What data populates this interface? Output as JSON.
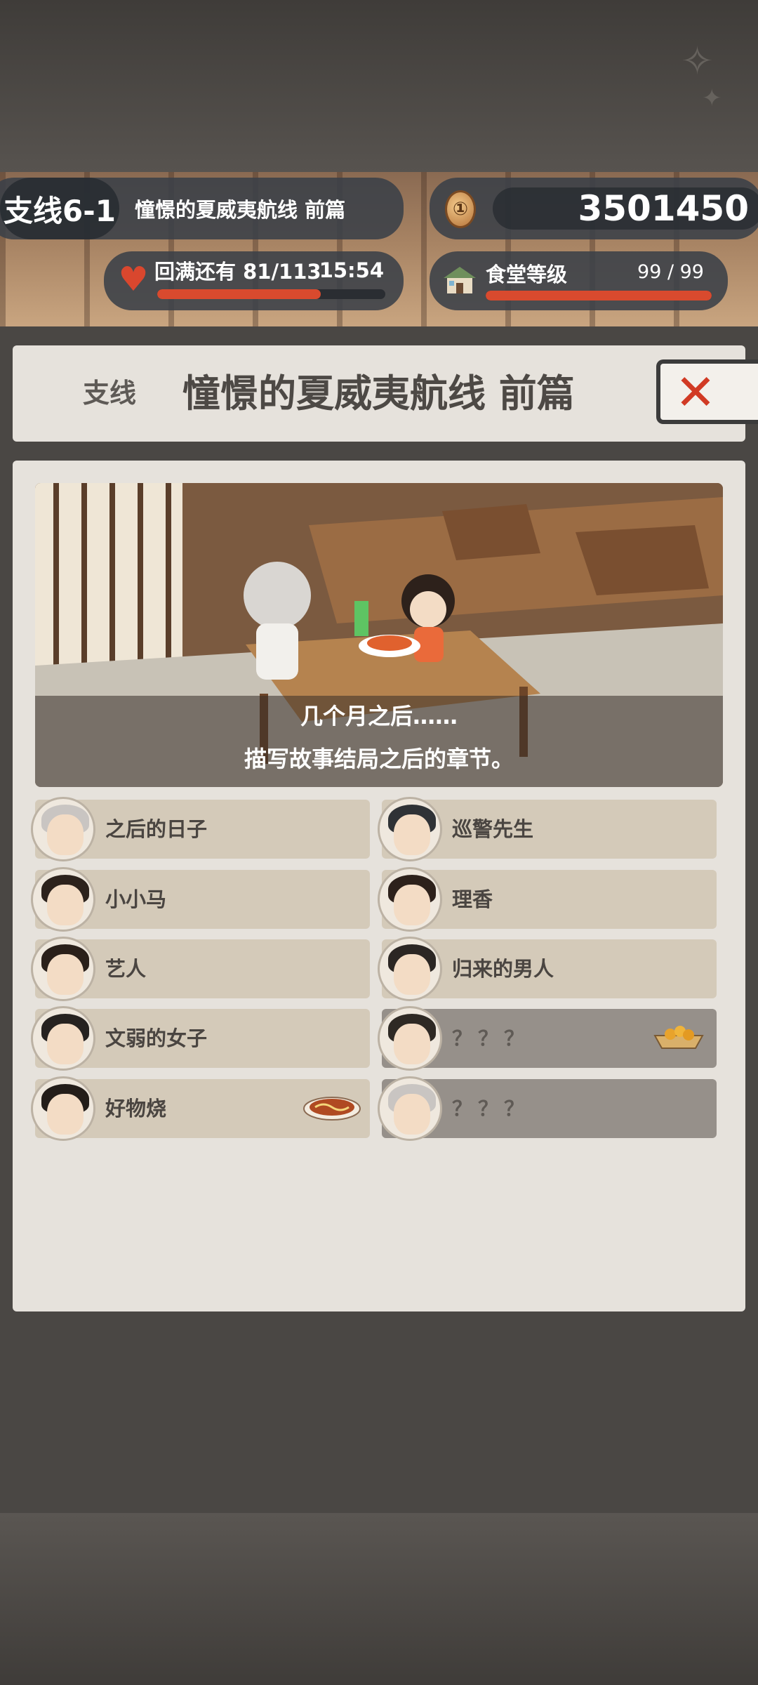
{
  "hud": {
    "chapter_code": "支线6-1",
    "chapter_title": "憧憬的夏威夷航线 前篇",
    "coins": "3501450",
    "coin_icon_glyph": "①",
    "stamina_text": "回满还有 81/113",
    "stamina_time": "15:54",
    "stamina_fraction": 0.717,
    "level_label": "食堂等级",
    "level_value": "99 / 99",
    "level_fraction": 1.0
  },
  "header": {
    "tag": "支线",
    "title": "憧憬的夏威夷航线 前篇",
    "close_glyph": "✕"
  },
  "scene": {
    "caption_line1": "几个月之后……",
    "caption_line2": "描写故事结局之后的章节。"
  },
  "stories": [
    {
      "label": "之后的日子",
      "locked": false,
      "hair": "#c9c5c2",
      "dish": ""
    },
    {
      "label": "巡警先生",
      "locked": false,
      "hair": "#2f3236",
      "dish": ""
    },
    {
      "label": "小小马",
      "locked": false,
      "hair": "#2c221c",
      "dish": ""
    },
    {
      "label": "理香",
      "locked": false,
      "hair": "#2d211b",
      "dish": ""
    },
    {
      "label": "艺人",
      "locked": false,
      "hair": "#2a201a",
      "dish": ""
    },
    {
      "label": "归来的男人",
      "locked": false,
      "hair": "#2b2623",
      "dish": ""
    },
    {
      "label": "文弱的女子",
      "locked": false,
      "hair": "#262220",
      "dish": ""
    },
    {
      "label": "？？？",
      "locked": true,
      "hair": "#2e2924",
      "dish": "takoyaki-icon"
    },
    {
      "label": "好物烧",
      "locked": false,
      "hair": "#231d19",
      "dish": "okonomiyaki-icon"
    },
    {
      "label": "？？？",
      "locked": true,
      "hair": "#c9c5c2",
      "dish": ""
    }
  ],
  "colors": {
    "accent_red": "#d94a2e",
    "panel_bg": "#e6e2dc",
    "item_bg": "#d4cab9",
    "item_locked_bg": "#96908a"
  }
}
